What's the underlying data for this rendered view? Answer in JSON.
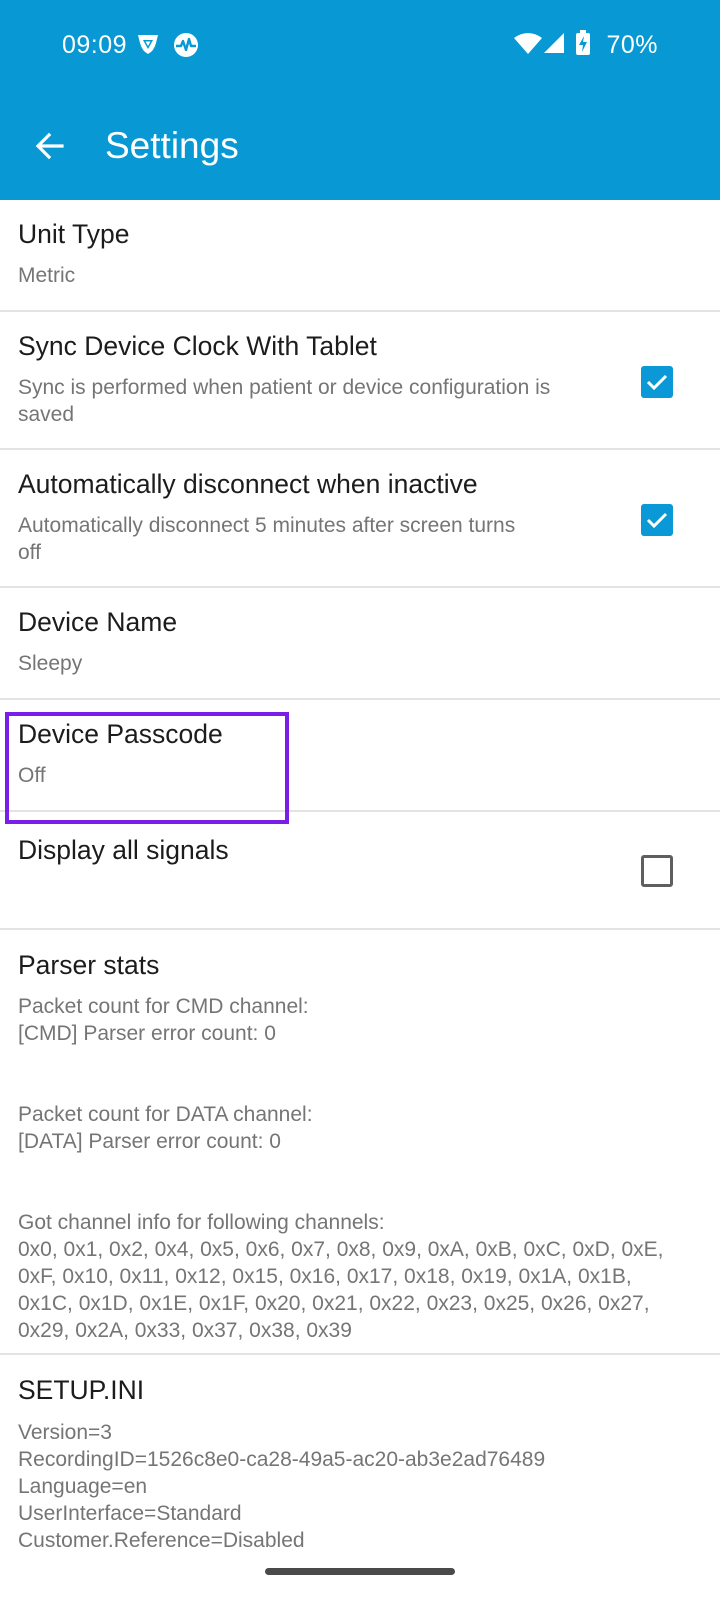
{
  "status_bar": {
    "time": "09:09",
    "battery": "70%",
    "icons": [
      "vpn-shield-icon",
      "activity-icon",
      "wifi-icon",
      "cell-signal-icon",
      "battery-charging-icon"
    ]
  },
  "toolbar": {
    "title": "Settings",
    "back_icon": "arrow-left-icon",
    "background": "#0899d4"
  },
  "preferences": [
    {
      "title": "Unit Type",
      "summary": "Metric"
    },
    {
      "title": "Sync Device Clock With Tablet",
      "summary": "Sync is performed when patient or device configuration is\nsaved",
      "checked": true
    },
    {
      "title": "Automatically disconnect when inactive",
      "summary": "Automatically disconnect 5 minutes after screen turns\noff",
      "checked": true
    },
    {
      "title": "Device Name",
      "summary": "Sleepy"
    },
    {
      "title": "Device Passcode",
      "summary": "Off"
    },
    {
      "title": "Display all signals",
      "checked": false
    },
    {
      "title": "Parser stats",
      "summary": "Packet count for CMD channel:\n[CMD] Parser error count: 0\n\n\nPacket count for DATA channel:\n[DATA] Parser error count: 0\n\n\nGot channel info for following channels:\n0x0, 0x1, 0x2, 0x4, 0x5, 0x6, 0x7, 0x8, 0x9, 0xA, 0xB, 0xC, 0xD, 0xE,\n0xF, 0x10, 0x11, 0x12, 0x15, 0x16, 0x17, 0x18, 0x19, 0x1A, 0x1B,\n0x1C, 0x1D, 0x1E, 0x1F, 0x20, 0x21, 0x22, 0x23, 0x25, 0x26, 0x27,\n0x29, 0x2A, 0x33, 0x37, 0x38, 0x39"
    },
    {
      "title": "SETUP.INI",
      "summary": "Version=3\nRecordingID=1526c8e0-ca28-49a5-ac20-ab3e2ad76489\nLanguage=en\nUserInterface=Standard\nCustomer.Reference=Disabled"
    }
  ],
  "accent_color": "#0a99d6",
  "highlight_color": "#7a1fe8"
}
